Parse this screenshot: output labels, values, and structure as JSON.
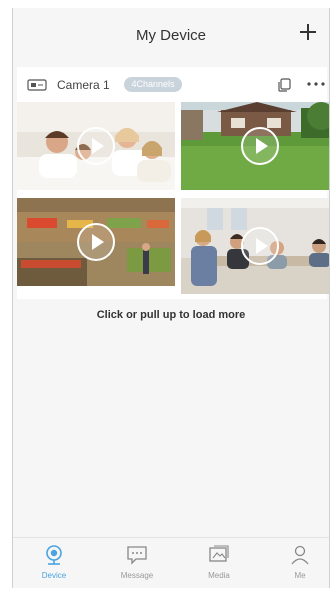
{
  "header": {
    "title": "My Device"
  },
  "camera": {
    "name": "Camera 1",
    "badge": "4Channels"
  },
  "feeds": [
    {
      "scene": "family"
    },
    {
      "scene": "backyard"
    },
    {
      "scene": "store"
    },
    {
      "scene": "office"
    }
  ],
  "load_more": "Click or pull up to load more",
  "tabs": [
    {
      "label": "Device",
      "icon": "device-icon",
      "active": true
    },
    {
      "label": "Message",
      "icon": "message-icon",
      "active": false
    },
    {
      "label": "Media",
      "icon": "media-icon",
      "active": false
    },
    {
      "label": "Me",
      "icon": "person-icon",
      "active": false
    }
  ],
  "colors": {
    "accent": "#4aa3e0",
    "background": "#f6f6f6",
    "badge": "#c9d3dc"
  }
}
